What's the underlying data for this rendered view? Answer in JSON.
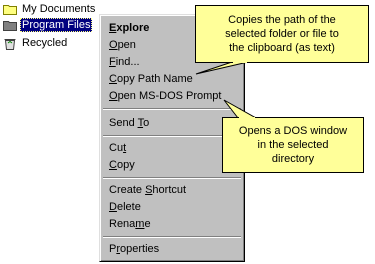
{
  "tree": {
    "items": [
      {
        "label": "My Documents",
        "icon": "folder-icon"
      },
      {
        "label": "Program Files",
        "icon": "folder-icon",
        "selected": true
      },
      {
        "label": "Recycled",
        "icon": "recycle-bin-icon"
      }
    ]
  },
  "menu": {
    "explore": "Explore",
    "open": "Open",
    "find": "Find...",
    "copy_path_name": "Copy Path Name",
    "open_msdos_prompt": "Open MS-DOS Prompt",
    "send_to": "Send To",
    "cut": "Cut",
    "copy": "Copy",
    "create_shortcut": "Create Shortcut",
    "delete": "Delete",
    "rename": "Rename",
    "properties": "Properties"
  },
  "callouts": {
    "copy_path": [
      "Copies the path of the",
      "selected folder or file to",
      "the clipboard (as text)"
    ],
    "dos_prompt": [
      "Opens a DOS window",
      "in the selected",
      "directory"
    ]
  },
  "colors": {
    "selection": "#000080",
    "menu_face": "#c0c0c0",
    "callout_fill": "#ffff99"
  }
}
